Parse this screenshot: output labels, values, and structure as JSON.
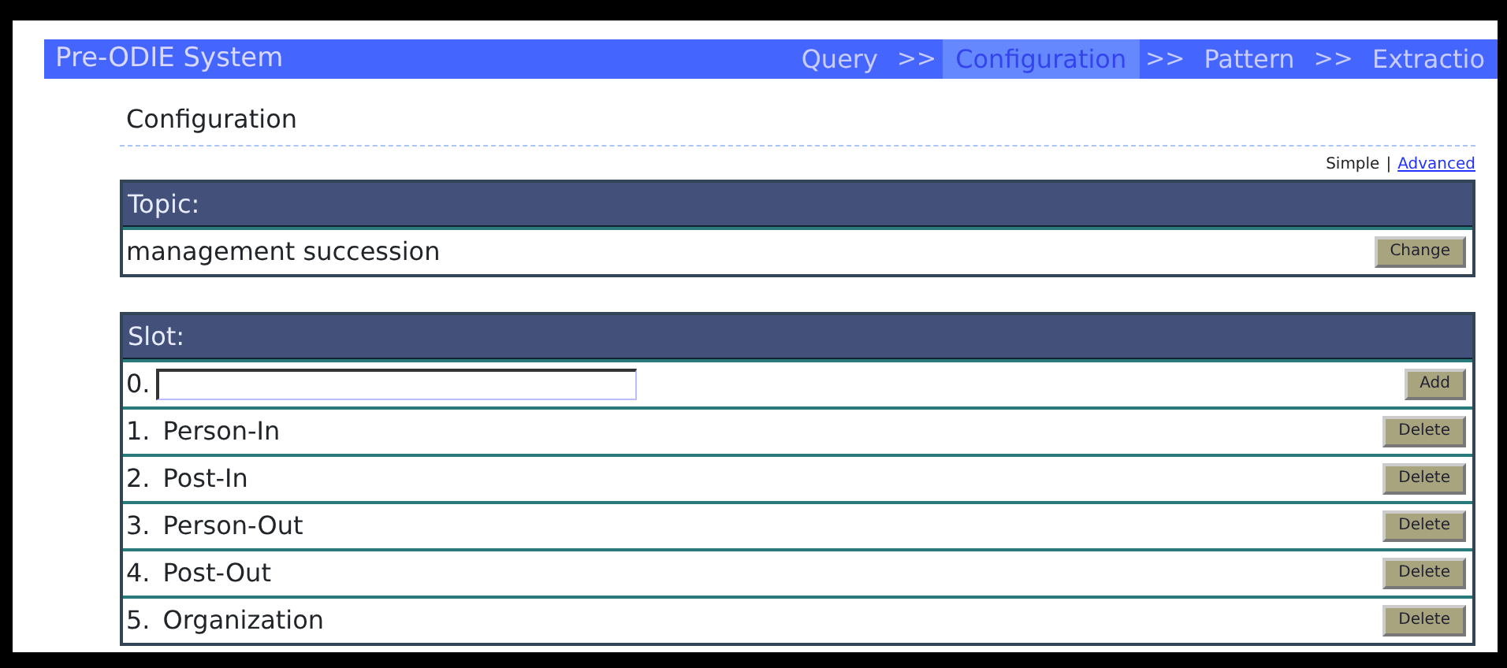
{
  "app_title": "Pre-ODIE System",
  "steps": [
    {
      "kind": "step",
      "label": "Query",
      "selected": false
    },
    {
      "kind": "separator",
      "label": ">>"
    },
    {
      "kind": "step",
      "label": "Configuration",
      "selected": true
    },
    {
      "kind": "separator",
      "label": ">>"
    },
    {
      "kind": "step",
      "label": "Pattern",
      "selected": false
    },
    {
      "kind": "separator",
      "label": ">>"
    },
    {
      "kind": "step",
      "label": "Extractio",
      "selected": false
    }
  ],
  "page_title": "Configuration",
  "modes": [
    {
      "kind": "mode",
      "label": "Simple",
      "selected": true
    },
    {
      "kind": "separator",
      "label": "|"
    },
    {
      "kind": "mode",
      "label": "Advanced",
      "selected": false
    }
  ],
  "topic": {
    "header": "Topic:",
    "value": "management succession",
    "button": "Change"
  },
  "slots": {
    "header": "Slot:",
    "rows": [
      {
        "kind": "input",
        "number": "0.",
        "button": "Add"
      },
      {
        "kind": "item",
        "number": "1.",
        "label": "Person-In",
        "button": "Delete"
      },
      {
        "kind": "item",
        "number": "2.",
        "label": "Post-In",
        "button": "Delete"
      },
      {
        "kind": "item",
        "number": "3.",
        "label": "Person-Out",
        "button": "Delete"
      },
      {
        "kind": "item",
        "number": "4.",
        "label": "Post-Out",
        "button": "Delete"
      },
      {
        "kind": "item",
        "number": "5.",
        "label": "Organization",
        "button": "Delete"
      }
    ]
  }
}
